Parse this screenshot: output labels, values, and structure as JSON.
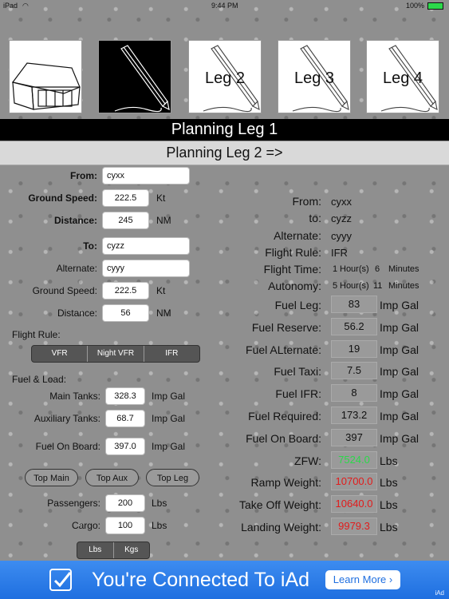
{
  "status_bar": {
    "device": "iPad",
    "time": "9:44 PM",
    "battery": "100%"
  },
  "tiles": [
    {
      "label": ""
    },
    {
      "label": ""
    },
    {
      "label": "Leg 2"
    },
    {
      "label": "Leg 3"
    },
    {
      "label": "Leg 4"
    }
  ],
  "header": {
    "title": "Planning Leg 1",
    "next": "Planning Leg 2 =>"
  },
  "form": {
    "from_label": "From:",
    "from_value": "cyxx",
    "ground_speed_label": "Ground Speed:",
    "ground_speed_value": "222.5",
    "speed_unit": "Kt",
    "distance_label": "Distance:",
    "distance_value": "245",
    "distance_unit": "NM",
    "to_label": "To:",
    "to_value": "cyzz",
    "alternate_label": "Alternate:",
    "alternate_value": "cyyy",
    "alt_ground_speed_label": "Ground Speed:",
    "alt_ground_speed_value": "222.5",
    "alt_speed_unit": "Kt",
    "alt_distance_label": "Distance:",
    "alt_distance_value": "56",
    "alt_distance_unit": "NM",
    "flight_rule_label": "Flight Rule:",
    "flight_rule_options": [
      "VFR",
      "Night VFR",
      "IFR"
    ],
    "fuel_load_label": "Fuel & Load:",
    "main_tanks_label": "Main Tanks:",
    "main_tanks_value": "328.3",
    "main_tanks_unit": "Imp Gal",
    "aux_tanks_label": "Auxiliary Tanks:",
    "aux_tanks_value": "68.7",
    "aux_tanks_unit": "Imp Gal",
    "fuel_on_board_label": "Fuel On Board:",
    "fuel_on_board_value": "397.0",
    "fuel_on_board_unit": "Imp Gal",
    "buttons": {
      "top_main": "Top Main",
      "top_aux": "Top Aux",
      "top_leg": "Top Leg"
    },
    "passengers_label": "Passengers:",
    "passengers_value": "200",
    "passengers_unit": "Lbs",
    "cargo_label": "Cargo:",
    "cargo_value": "100",
    "cargo_unit": "Lbs",
    "weight_units": [
      "Lbs",
      "Kgs"
    ]
  },
  "summary": {
    "from_label": "From:",
    "from_value": "cyxx",
    "to_label": "to:",
    "to_value": "cyzz",
    "alternate_label": "Alternate:",
    "alternate_value": "cyyy",
    "flight_rule_label": "Flight Rule:",
    "flight_rule_value": "IFR",
    "flight_time_label": "Flight Time:",
    "flight_time_hours": "1",
    "hours_unit": "Hour(s)",
    "flight_time_minutes": "6",
    "minutes_unit": "Minutes",
    "autonomy_label": "Autonomy:",
    "autonomy_hours": "5",
    "autonomy_hours_unit": "Hour(s)",
    "autonomy_minutes": "11",
    "autonomy_minutes_unit": "Minutes",
    "rows": [
      {
        "label": "Fuel Leg:",
        "value": "83",
        "unit": "Imp Gal",
        "color": ""
      },
      {
        "label": "Fuel Reserve:",
        "value": "56.2",
        "unit": "Imp Gal",
        "color": ""
      },
      {
        "label": "Fuel ALternate:",
        "value": "19",
        "unit": "Imp Gal",
        "color": ""
      },
      {
        "label": "Fuel Taxi:",
        "value": "7.5",
        "unit": "Imp Gal",
        "color": ""
      },
      {
        "label": "Fuel IFR:",
        "value": "8",
        "unit": "Imp Gal",
        "color": ""
      },
      {
        "label": "Fuel Required:",
        "value": "173.2",
        "unit": "Imp Gal",
        "color": ""
      },
      {
        "label": "Fuel On Board:",
        "value": "397",
        "unit": "Imp Gal",
        "color": ""
      },
      {
        "label": "ZFW:",
        "value": "7524.0",
        "unit": "Lbs",
        "color": "#2bd94a"
      },
      {
        "label": "Ramp Weight:",
        "value": "10700.0",
        "unit": "Lbs",
        "color": "#e21b1b"
      },
      {
        "label": "Take Off Weight:",
        "value": "10640.0",
        "unit": "Lbs",
        "color": "#e21b1b"
      },
      {
        "label": "Landing Weight:",
        "value": "9979.3",
        "unit": "Lbs",
        "color": "#e21b1b"
      }
    ]
  },
  "ad": {
    "text": "You're Connected To iAd",
    "button": "Learn More ›",
    "badge": "iAd"
  }
}
